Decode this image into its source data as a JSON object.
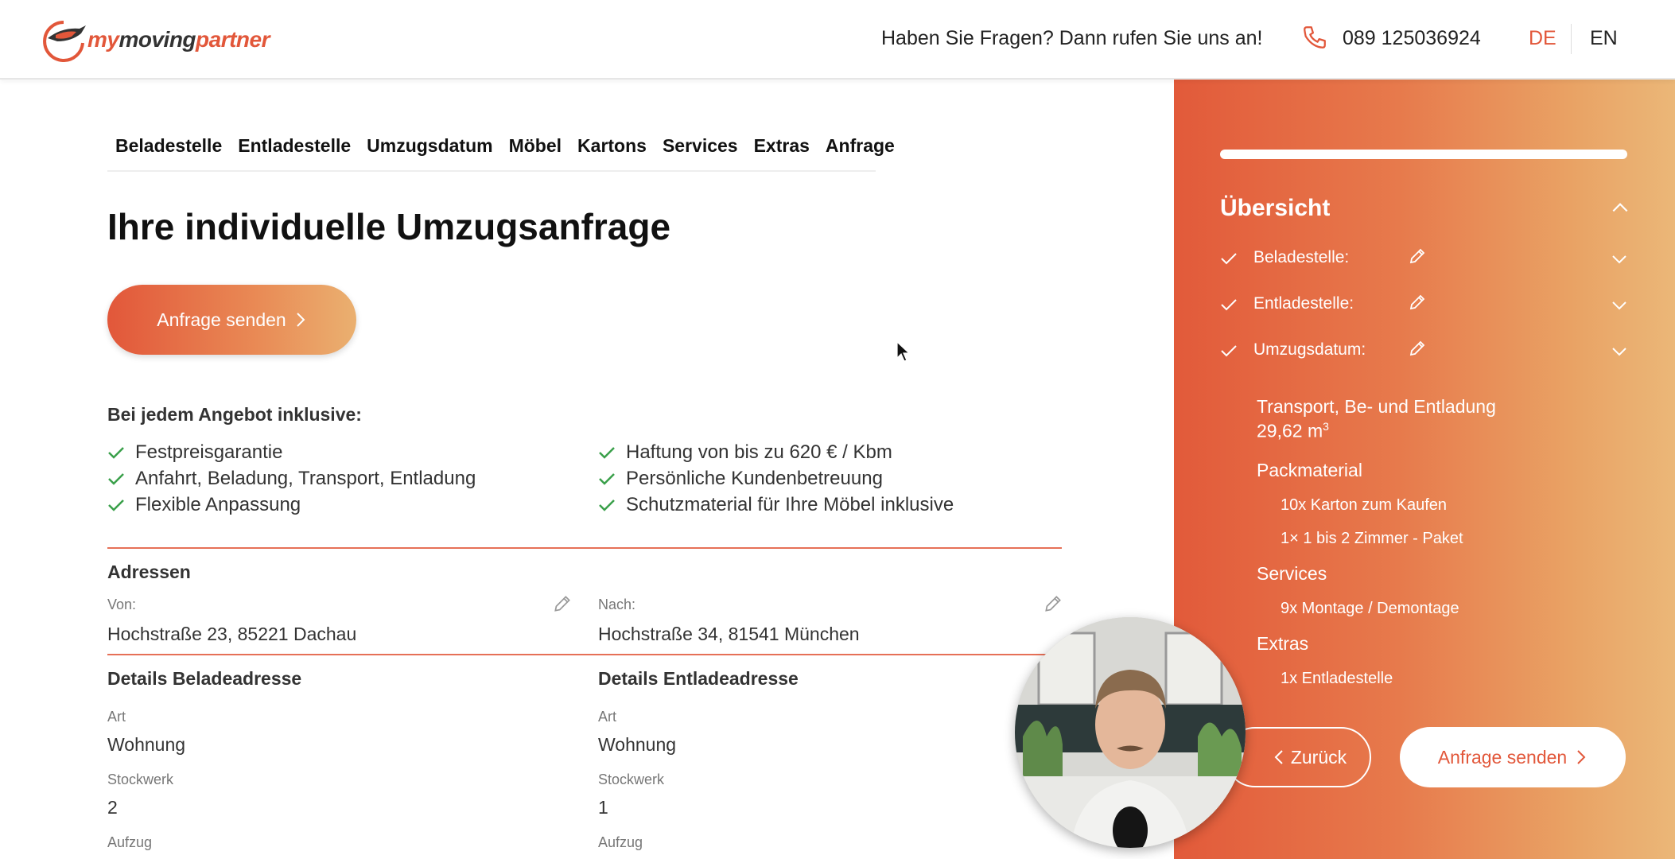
{
  "header": {
    "logo": {
      "my": "my",
      "moving": "moving",
      "partner": "partner"
    },
    "question": "Haben Sie Fragen? Dann rufen Sie uns an!",
    "phone": "089 125036924",
    "lang_de": "DE",
    "lang_en": "EN"
  },
  "steps": [
    "Beladestelle",
    "Entladestelle",
    "Umzugsdatum",
    "Möbel",
    "Kartons",
    "Services",
    "Extras",
    "Anfrage"
  ],
  "title": {
    "normal": "Ihre individuelle ",
    "bold": "Umzugsanfrage"
  },
  "send_button": "Anfrage senden",
  "included": {
    "title": "Bei jedem Angebot inklusive:",
    "left": [
      "Festpreisgarantie",
      "Anfahrt, Beladung, Transport, Entladung",
      "Flexible Anpassung"
    ],
    "right": [
      "Haftung von bis zu 620 € / Kbm",
      "Persönliche Kundenbetreuung",
      "Schutzmaterial für Ihre Möbel inklusive"
    ]
  },
  "addresses": {
    "title": "Adressen",
    "from_label": "Von:",
    "from_value": "Hochstraße 23, 85221 Dachau",
    "to_label": "Nach:",
    "to_value": "Hochstraße 34, 81541 München"
  },
  "details_load": {
    "title": "Details Beladeadresse",
    "art_label": "Art",
    "art_value": "Wohnung",
    "floor_label": "Stockwerk",
    "floor_value": "2",
    "lift_label": "Aufzug"
  },
  "details_unload": {
    "title": "Details Entladeadresse",
    "art_label": "Art",
    "art_value": "Wohnung",
    "floor_label": "Stockwerk",
    "floor_value": "1",
    "lift_label": "Aufzug"
  },
  "sidebar": {
    "title": "Übersicht",
    "rows": [
      "Beladestelle:",
      "Entladestelle:",
      "Umzugsdatum:"
    ],
    "transport": "Transport, Be- und Entladung",
    "volume": "29,62 m",
    "volume_sup": "3",
    "packmaterial": "Packmaterial",
    "pack_items": [
      "10x Karton zum Kaufen",
      "1× 1 bis 2 Zimmer - Paket"
    ],
    "services": "Services",
    "service_items": [
      "9x Montage / Demontage"
    ],
    "extras": "Extras",
    "extra_items": [
      "1x Entladestelle"
    ],
    "back": "Zurück",
    "send": "Anfrage senden"
  },
  "colors": {
    "accent": "#e2573a",
    "check": "#3aa04a"
  }
}
